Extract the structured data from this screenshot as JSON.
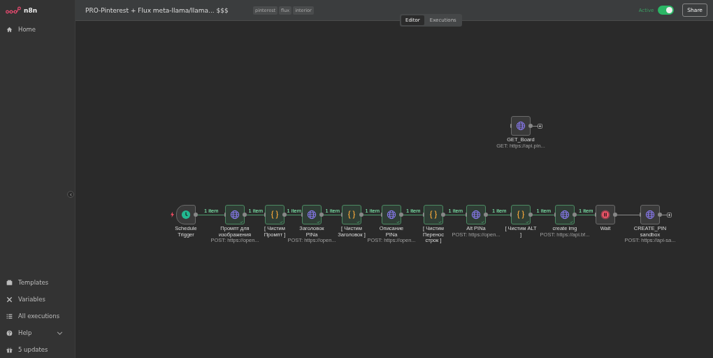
{
  "sidebar": {
    "logo": "n8n",
    "items": [
      {
        "label": "Home",
        "selected": false
      }
    ],
    "bottom_items": [
      {
        "label": "Templates"
      },
      {
        "label": "Variables"
      },
      {
        "label": "All executions"
      },
      {
        "label": "Help",
        "expandable": true
      },
      {
        "label": "5 updates"
      }
    ]
  },
  "header": {
    "title": "PRO-Pinterest + Flux meta-llama/llama... $$$",
    "tags": [
      "pinterest",
      "flux",
      "interior"
    ],
    "active_label": "Active",
    "active": true,
    "share": "Share"
  },
  "tabs": [
    {
      "label": "Editor",
      "selected": true
    },
    {
      "label": "Executions",
      "selected": false
    }
  ],
  "workflow": {
    "nodes": [
      {
        "kind": "trigger",
        "name": "Schedule Trigger",
        "success": false,
        "output_label": "1 item"
      },
      {
        "kind": "http",
        "name": "Промпт для изображения",
        "subtitle": "POST: https://open...",
        "success": true,
        "output_label": "1 item"
      },
      {
        "kind": "code",
        "name": "[ Чистим Промпт ]",
        "success": true,
        "output_label": "1 item"
      },
      {
        "kind": "http",
        "name": "Заголовок PINа",
        "subtitle": "POST: https://open...",
        "success": true,
        "output_label": "1 item"
      },
      {
        "kind": "code",
        "name": "[ Чистим Заголовок ]",
        "success": true,
        "output_label": "1 item"
      },
      {
        "kind": "http",
        "name": "Описание PINа",
        "subtitle": "POST: https://open...",
        "success": true,
        "output_label": "1 item"
      },
      {
        "kind": "code",
        "name": "[ Чистим Перенос строк ]",
        "success": true,
        "output_label": "1 item"
      },
      {
        "kind": "http",
        "name": "Alt PINa",
        "subtitle": "POST: https://open...",
        "success": true,
        "output_label": "1 item"
      },
      {
        "kind": "code",
        "name": "[ Чистим ALT ]",
        "success": true,
        "output_label": "1 item"
      },
      {
        "kind": "http",
        "name": "create img",
        "subtitle": "POST: https://api.bf...",
        "success": true,
        "output_label": "1 item"
      },
      {
        "kind": "wait",
        "name": "Wait",
        "success": false
      },
      {
        "kind": "http",
        "name": "CREATE_PIN sandbox",
        "subtitle": "POST: https://api-sa...",
        "success": false
      }
    ],
    "detached_nodes": [
      {
        "kind": "http",
        "name": "GET_Board",
        "subtitle": "GET: https://api.pin...",
        "success": false
      }
    ]
  }
}
